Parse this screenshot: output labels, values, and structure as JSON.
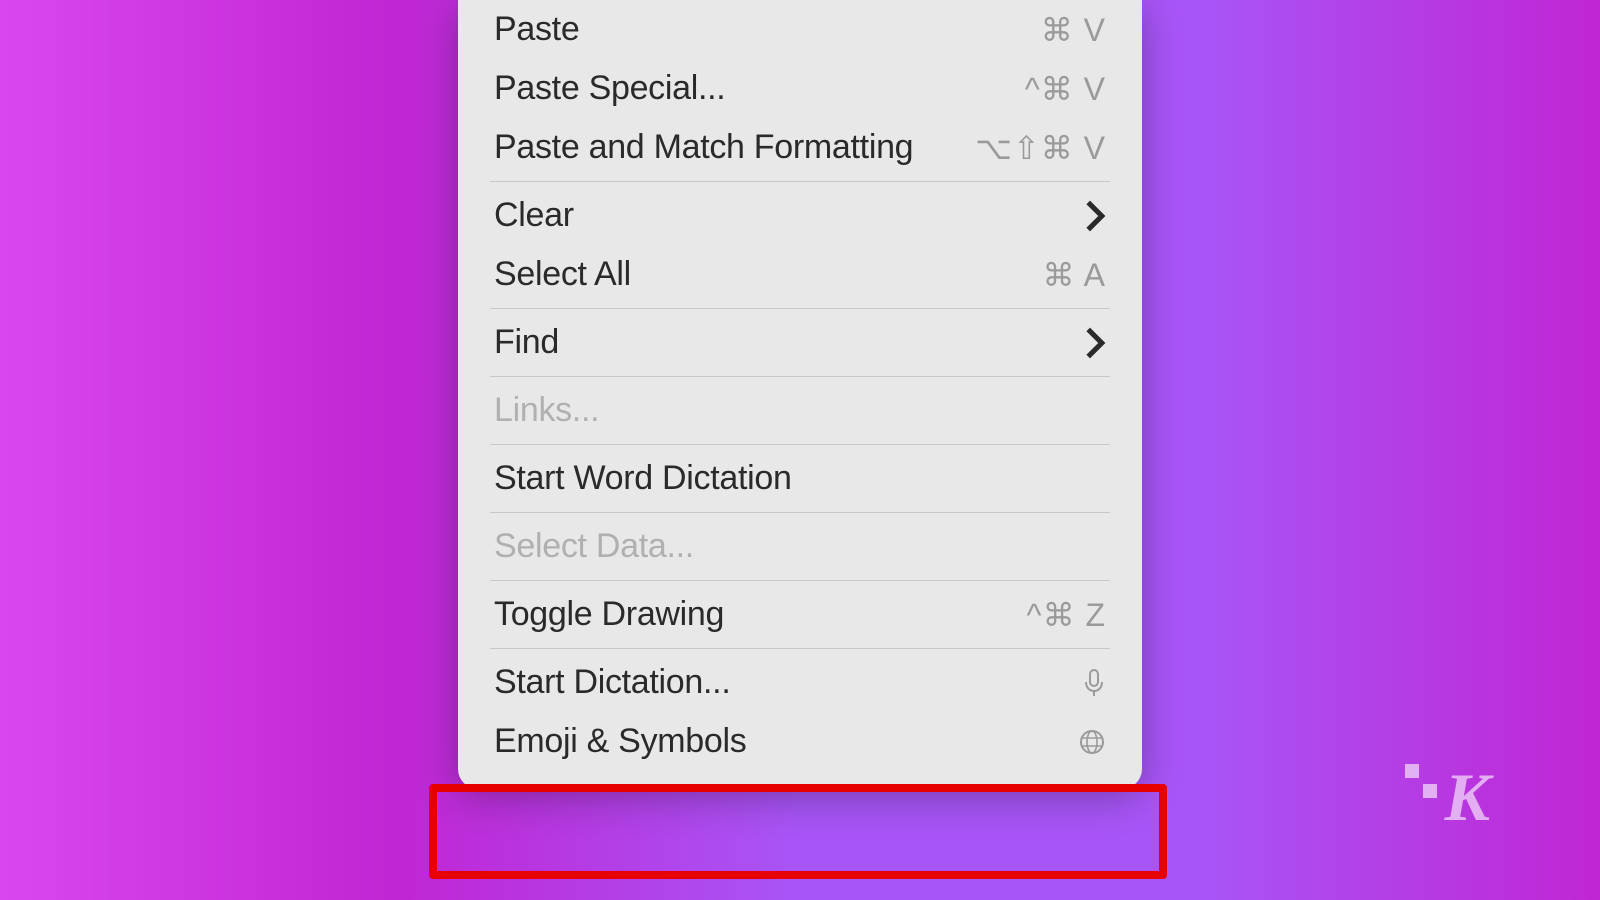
{
  "menu": {
    "items": [
      {
        "label": "Paste",
        "shortcut": "⌘ V",
        "type": "shortcut"
      },
      {
        "label": "Paste Special...",
        "shortcut": "^⌘ V",
        "type": "shortcut"
      },
      {
        "label": "Paste and Match Formatting",
        "shortcut": "⌥⇧⌘ V",
        "type": "shortcut"
      }
    ],
    "items2": [
      {
        "label": "Clear",
        "type": "submenu"
      },
      {
        "label": "Select All",
        "shortcut": "⌘ A",
        "type": "shortcut"
      }
    ],
    "items3": [
      {
        "label": "Find",
        "type": "submenu"
      }
    ],
    "items4": [
      {
        "label": "Links...",
        "disabled": true
      }
    ],
    "items5": [
      {
        "label": "Start Word Dictation"
      }
    ],
    "items6": [
      {
        "label": "Select Data...",
        "disabled": true
      }
    ],
    "items7": [
      {
        "label": "Toggle Drawing",
        "shortcut": "^⌘ Z",
        "type": "shortcut"
      }
    ],
    "items8": [
      {
        "label": "Start Dictation...",
        "type": "mic"
      },
      {
        "label": "Emoji & Symbols",
        "type": "globe"
      }
    ]
  },
  "logo": {
    "letter": "K"
  }
}
